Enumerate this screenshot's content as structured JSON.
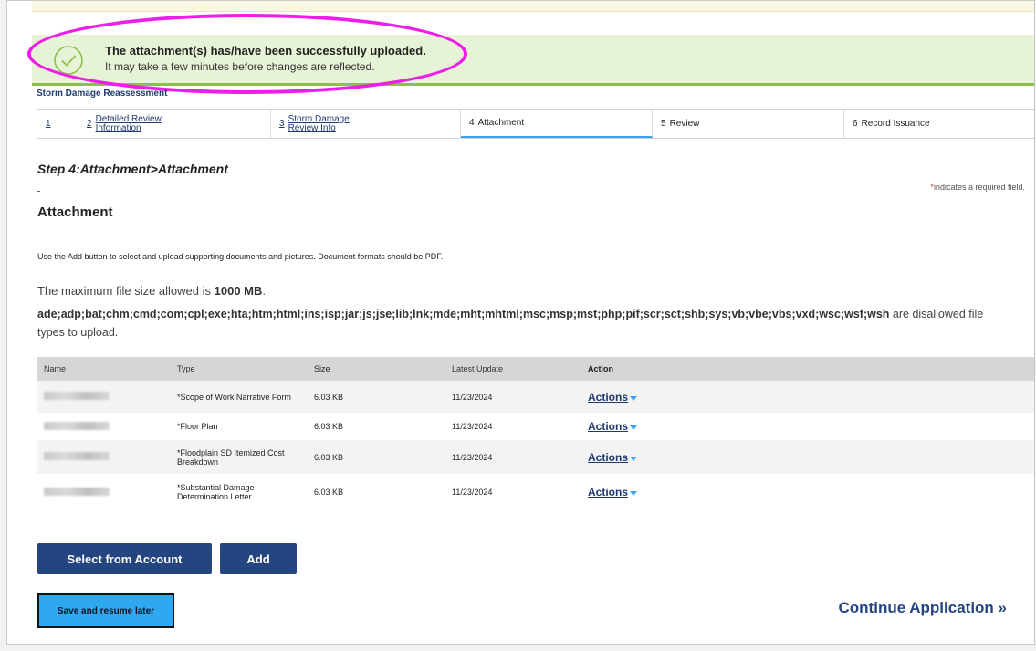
{
  "banner": {
    "icon": "check-circle-icon",
    "title": "The attachment(s) has/have been successfully uploaded.",
    "subtitle": "It may take a few minutes before changes are reflected.",
    "accent_color": "#8dc04a"
  },
  "flow_title": "Storm Damage Reassessment",
  "steps": [
    {
      "num": "1",
      "label": ""
    },
    {
      "num": "2",
      "label": "Detailed Review Information"
    },
    {
      "num": "3",
      "label": "Storm Damage Review Info"
    },
    {
      "num": "4",
      "label": "Attachment"
    },
    {
      "num": "5",
      "label": "Review"
    },
    {
      "num": "6",
      "label": "Record Issuance"
    }
  ],
  "step_title": "Step 4:Attachment>Attachment",
  "required_note": {
    "star": "*",
    "text": "indicates a required field."
  },
  "section_heading": "Attachment",
  "instructions": "Use the Add button to select and upload supporting documents and pictures. Document formats should be PDF.",
  "max_size": {
    "prefix": "The maximum file size allowed is ",
    "value": "1000 MB",
    "suffix": "."
  },
  "disallowed": {
    "types": "ade;adp;bat;chm;cmd;com;cpl;exe;hta;htm;html;ins;isp;jar;js;jse;lib;lnk;mde;mht;mhtml;msc;msp;mst;php;pif;scr;sct;shb;sys;vb;vbe;vbs;vxd;wsc;wsf;wsh",
    "suffix": " are disallowed file types to upload."
  },
  "table": {
    "headers": {
      "name": "Name",
      "type": "Type",
      "size": "Size",
      "latest_update": "Latest Update",
      "action": "Action"
    },
    "rows": [
      {
        "type": "*Scope of Work Narrative Form",
        "size": "6.03 KB",
        "date": "11/23/2024",
        "action": "Actions"
      },
      {
        "type": "*Floor Plan",
        "size": "6.03 KB",
        "date": "11/23/2024",
        "action": "Actions"
      },
      {
        "type": "*Floodplain SD Itemized Cost Breakdown",
        "size": "6.03 KB",
        "date": "11/23/2024",
        "action": "Actions"
      },
      {
        "type": "*Substantial Damage Determination Letter",
        "size": "6.03 KB",
        "date": "11/23/2024",
        "action": "Actions"
      }
    ]
  },
  "buttons": {
    "select_from_account": "Select from Account",
    "add": "Add",
    "save_resume": "Save and resume later",
    "continue": "Continue Application »"
  },
  "colors": {
    "primary_button": "#24457f",
    "save_button": "#2ea8f0",
    "active_tab": "#3ba3e8",
    "highlight": "#ee1de9"
  }
}
